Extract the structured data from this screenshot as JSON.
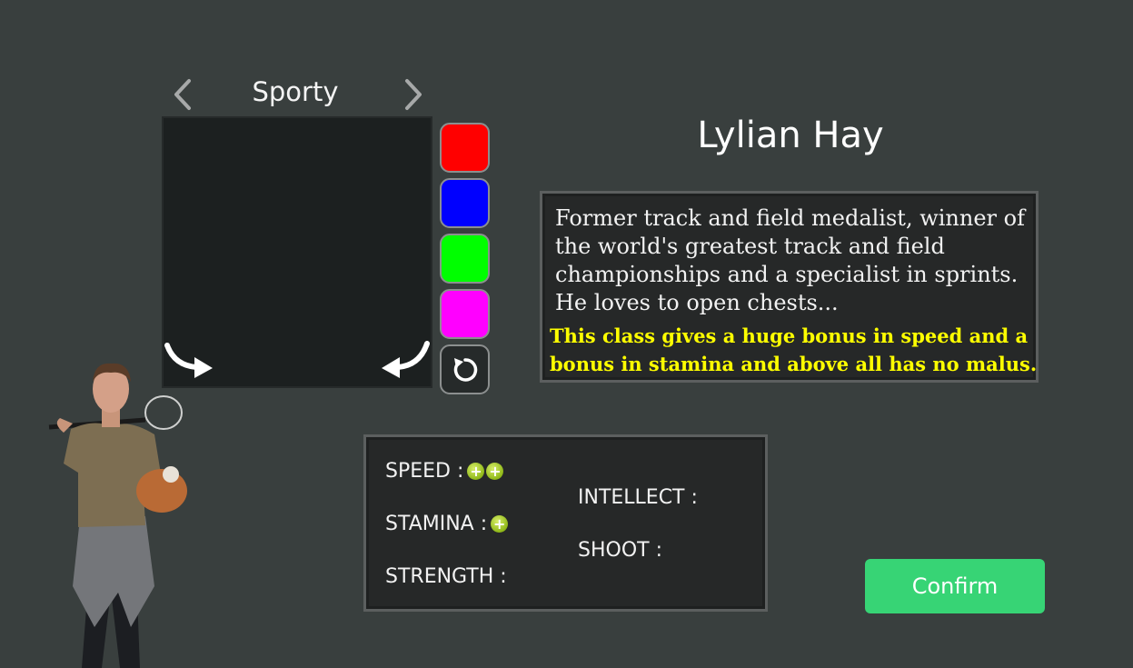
{
  "class_selector": {
    "current_class": "Sporty",
    "prev_icon": "chevron-left-icon",
    "next_icon": "chevron-right-icon"
  },
  "preview": {
    "rotate_right_icon": "curved-arrow-right-icon",
    "rotate_left_icon": "curved-arrow-left-icon"
  },
  "color_swatches": [
    {
      "name": "red",
      "color": "#ff0000"
    },
    {
      "name": "blue",
      "color": "#0000ff"
    },
    {
      "name": "green",
      "color": "#00ff00"
    },
    {
      "name": "magenta",
      "color": "#ff00ff"
    }
  ],
  "reset_icon": "reset-icon",
  "character": {
    "name": "Lylian Hay",
    "description": "Former track and field medalist, winner of the world's greatest track and field championships and a specialist in sprints. He loves to open chests...",
    "bonus_text": "This class gives a huge bonus in speed and a bonus in stamina and above all has no malus."
  },
  "stats": {
    "speed": {
      "label": "SPEED :",
      "bonus": 2
    },
    "intellect": {
      "label": "INTELLECT :",
      "bonus": 0
    },
    "stamina": {
      "label": "STAMINA :",
      "bonus": 1
    },
    "shoot": {
      "label": "SHOOT :",
      "bonus": 0
    },
    "strength": {
      "label": "STRENGTH :",
      "bonus": 0
    },
    "bonus_icon": "plus-icon"
  },
  "confirm_label": "Confirm",
  "colors": {
    "background": "#393f3e",
    "panel": "#262828",
    "bonus_text": "#ffff00",
    "confirm": "#37d475"
  }
}
